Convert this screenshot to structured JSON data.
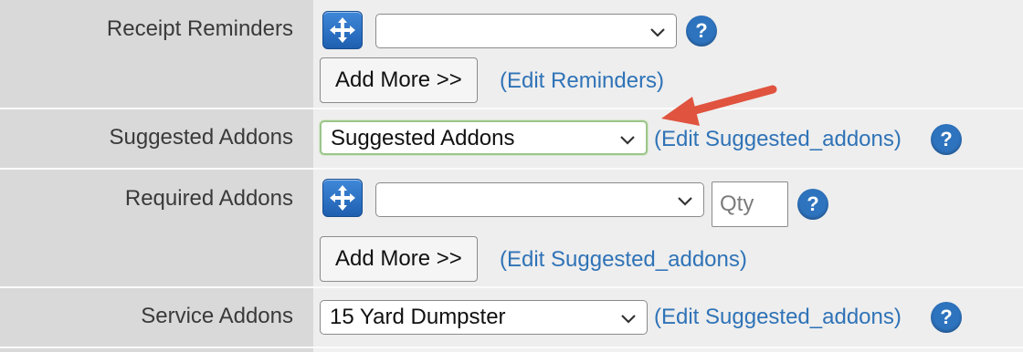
{
  "rows": {
    "receipt_reminders": {
      "label": "Receipt Reminders",
      "select_value": "",
      "help_icon": "question-mark-icon",
      "add_more_label": "Add More >>",
      "edit_link": "(Edit Reminders)"
    },
    "suggested_addons": {
      "label": "Suggested Addons",
      "select_value": "Suggested Addons",
      "edit_link": "(Edit Suggested_addons)",
      "help_icon": "question-mark-icon"
    },
    "required_addons": {
      "label": "Required Addons",
      "select_value": "",
      "qty_placeholder": "Qty",
      "help_icon": "question-mark-icon",
      "add_more_label": "Add More >>",
      "edit_link": "(Edit Suggested_addons)"
    },
    "service_addons": {
      "label": "Service Addons",
      "select_value": "15 Yard Dumpster",
      "edit_link": "(Edit Suggested_addons)",
      "help_icon": "question-mark-icon"
    }
  },
  "help_text": "?",
  "annotation": {
    "icon": "red-arrow-icon",
    "color": "#e0533f"
  },
  "colors": {
    "link": "#2f73b7",
    "label_bg": "#d9d9d9",
    "focus_border": "#9cc58a",
    "accent": "#2e73be"
  }
}
